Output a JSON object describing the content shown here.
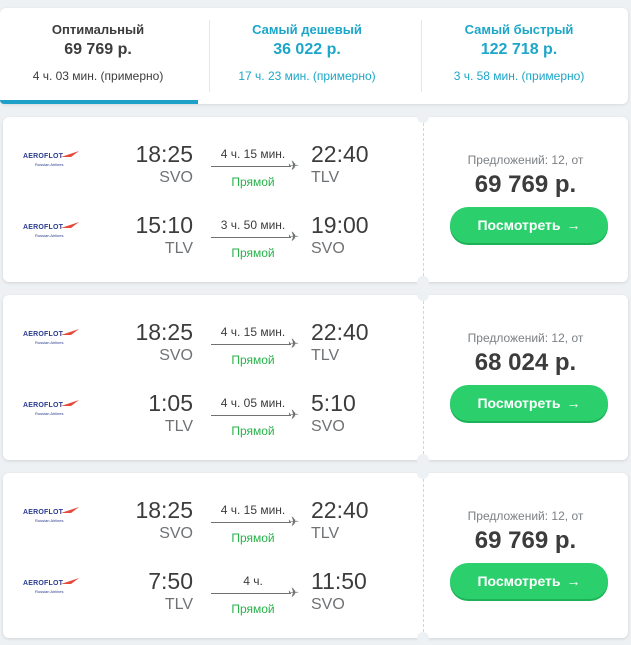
{
  "tabs": [
    {
      "title": "Оптимальный",
      "price": "69 769 р.",
      "time": "4 ч. 03 мин. (примерно)",
      "active": true
    },
    {
      "title": "Самый дешевый",
      "price": "36 022 р.",
      "time": "17 ч. 23 мин. (примерно)",
      "active": false
    },
    {
      "title": "Самый быстрый",
      "price": "122 718 р.",
      "time": "3 ч. 58 мин. (примерно)",
      "active": false
    }
  ],
  "airline": {
    "name": "AEROFLOT",
    "subtitle": "Russian Airlines"
  },
  "tickets": [
    {
      "offers": "Предложений: 12, от",
      "price": "69 769 р.",
      "button": "Посмотреть",
      "segments": [
        {
          "dep_time": "18:25",
          "dep_code": "SVO",
          "duration": "4 ч. 15 мин.",
          "stops": "Прямой",
          "arr_time": "22:40",
          "arr_code": "TLV"
        },
        {
          "dep_time": "15:10",
          "dep_code": "TLV",
          "duration": "3 ч. 50 мин.",
          "stops": "Прямой",
          "arr_time": "19:00",
          "arr_code": "SVO"
        }
      ]
    },
    {
      "offers": "Предложений: 12, от",
      "price": "68 024 р.",
      "button": "Посмотреть",
      "segments": [
        {
          "dep_time": "18:25",
          "dep_code": "SVO",
          "duration": "4 ч. 15 мин.",
          "stops": "Прямой",
          "arr_time": "22:40",
          "arr_code": "TLV"
        },
        {
          "dep_time": "1:05",
          "dep_code": "TLV",
          "duration": "4 ч. 05 мин.",
          "stops": "Прямой",
          "arr_time": "5:10",
          "arr_code": "SVO"
        }
      ]
    },
    {
      "offers": "Предложений: 12, от",
      "price": "69 769 р.",
      "button": "Посмотреть",
      "segments": [
        {
          "dep_time": "18:25",
          "dep_code": "SVO",
          "duration": "4 ч. 15 мин.",
          "stops": "Прямой",
          "arr_time": "22:40",
          "arr_code": "TLV"
        },
        {
          "dep_time": "7:50",
          "dep_code": "TLV",
          "duration": "4 ч.",
          "stops": "Прямой",
          "arr_time": "11:50",
          "arr_code": "SVO"
        }
      ]
    }
  ],
  "colors": {
    "accent": "#1ca6c9",
    "button": "#2bd06d",
    "direct": "#27b24a",
    "airline": "#2b3d8f"
  }
}
